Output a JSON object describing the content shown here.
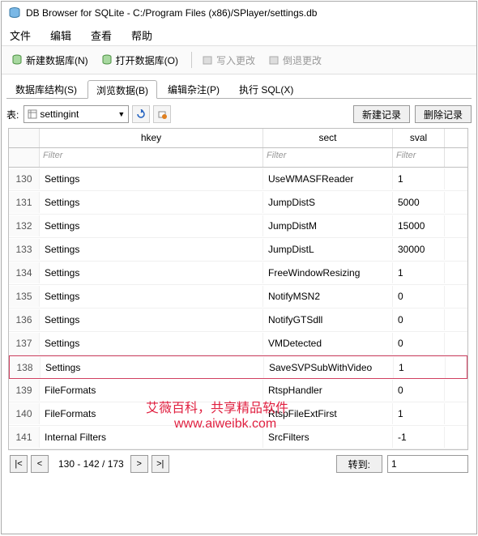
{
  "window": {
    "title": "DB Browser for SQLite - C:/Program Files (x86)/SPlayer/settings.db"
  },
  "menu": {
    "file": "文件",
    "edit": "编辑",
    "view": "查看",
    "help": "帮助"
  },
  "toolbar": {
    "new_db": "新建数据库(N)",
    "open_db": "打开数据库(O)",
    "write_changes": "写入更改",
    "revert_changes": "倒退更改"
  },
  "tabs": {
    "structure": "数据库结构(S)",
    "browse": "浏览数据(B)",
    "pragmas": "编辑杂注(P)",
    "sql": "执行 SQL(X)"
  },
  "browse": {
    "table_label": "表:",
    "table_selected": "settingint",
    "new_record": "新建记录",
    "delete_record": "删除记录"
  },
  "grid": {
    "columns": {
      "hkey": "hkey",
      "sect": "sect",
      "sval": "sval"
    },
    "filter_placeholder": "Filter",
    "rows": [
      {
        "num": "130",
        "hkey": "Settings",
        "sect": "UseWMASFReader",
        "sval": "1"
      },
      {
        "num": "131",
        "hkey": "Settings",
        "sect": "JumpDistS",
        "sval": "5000"
      },
      {
        "num": "132",
        "hkey": "Settings",
        "sect": "JumpDistM",
        "sval": "15000"
      },
      {
        "num": "133",
        "hkey": "Settings",
        "sect": "JumpDistL",
        "sval": "30000"
      },
      {
        "num": "134",
        "hkey": "Settings",
        "sect": "FreeWindowResizing",
        "sval": "1"
      },
      {
        "num": "135",
        "hkey": "Settings",
        "sect": "NotifyMSN2",
        "sval": "0"
      },
      {
        "num": "136",
        "hkey": "Settings",
        "sect": "NotifyGTSdll",
        "sval": "0"
      },
      {
        "num": "137",
        "hkey": "Settings",
        "sect": "VMDetected",
        "sval": "0"
      },
      {
        "num": "138",
        "hkey": "Settings",
        "sect": "SaveSVPSubWithVideo",
        "sval": "1",
        "highlighted": true
      },
      {
        "num": "139",
        "hkey": "FileFormats",
        "sect": "RtspHandler",
        "sval": "0"
      },
      {
        "num": "140",
        "hkey": "FileFormats",
        "sect": "RtspFileExtFirst",
        "sval": "1"
      },
      {
        "num": "141",
        "hkey": "Internal Filters",
        "sect": "SrcFilters",
        "sval": "-1"
      }
    ]
  },
  "pager": {
    "range": "130 - 142 / 173",
    "goto_label": "转到:",
    "goto_value": "1"
  },
  "watermark": {
    "line1": "艾薇百科，共享精品软件",
    "line2": "www.aiweibk.com"
  }
}
